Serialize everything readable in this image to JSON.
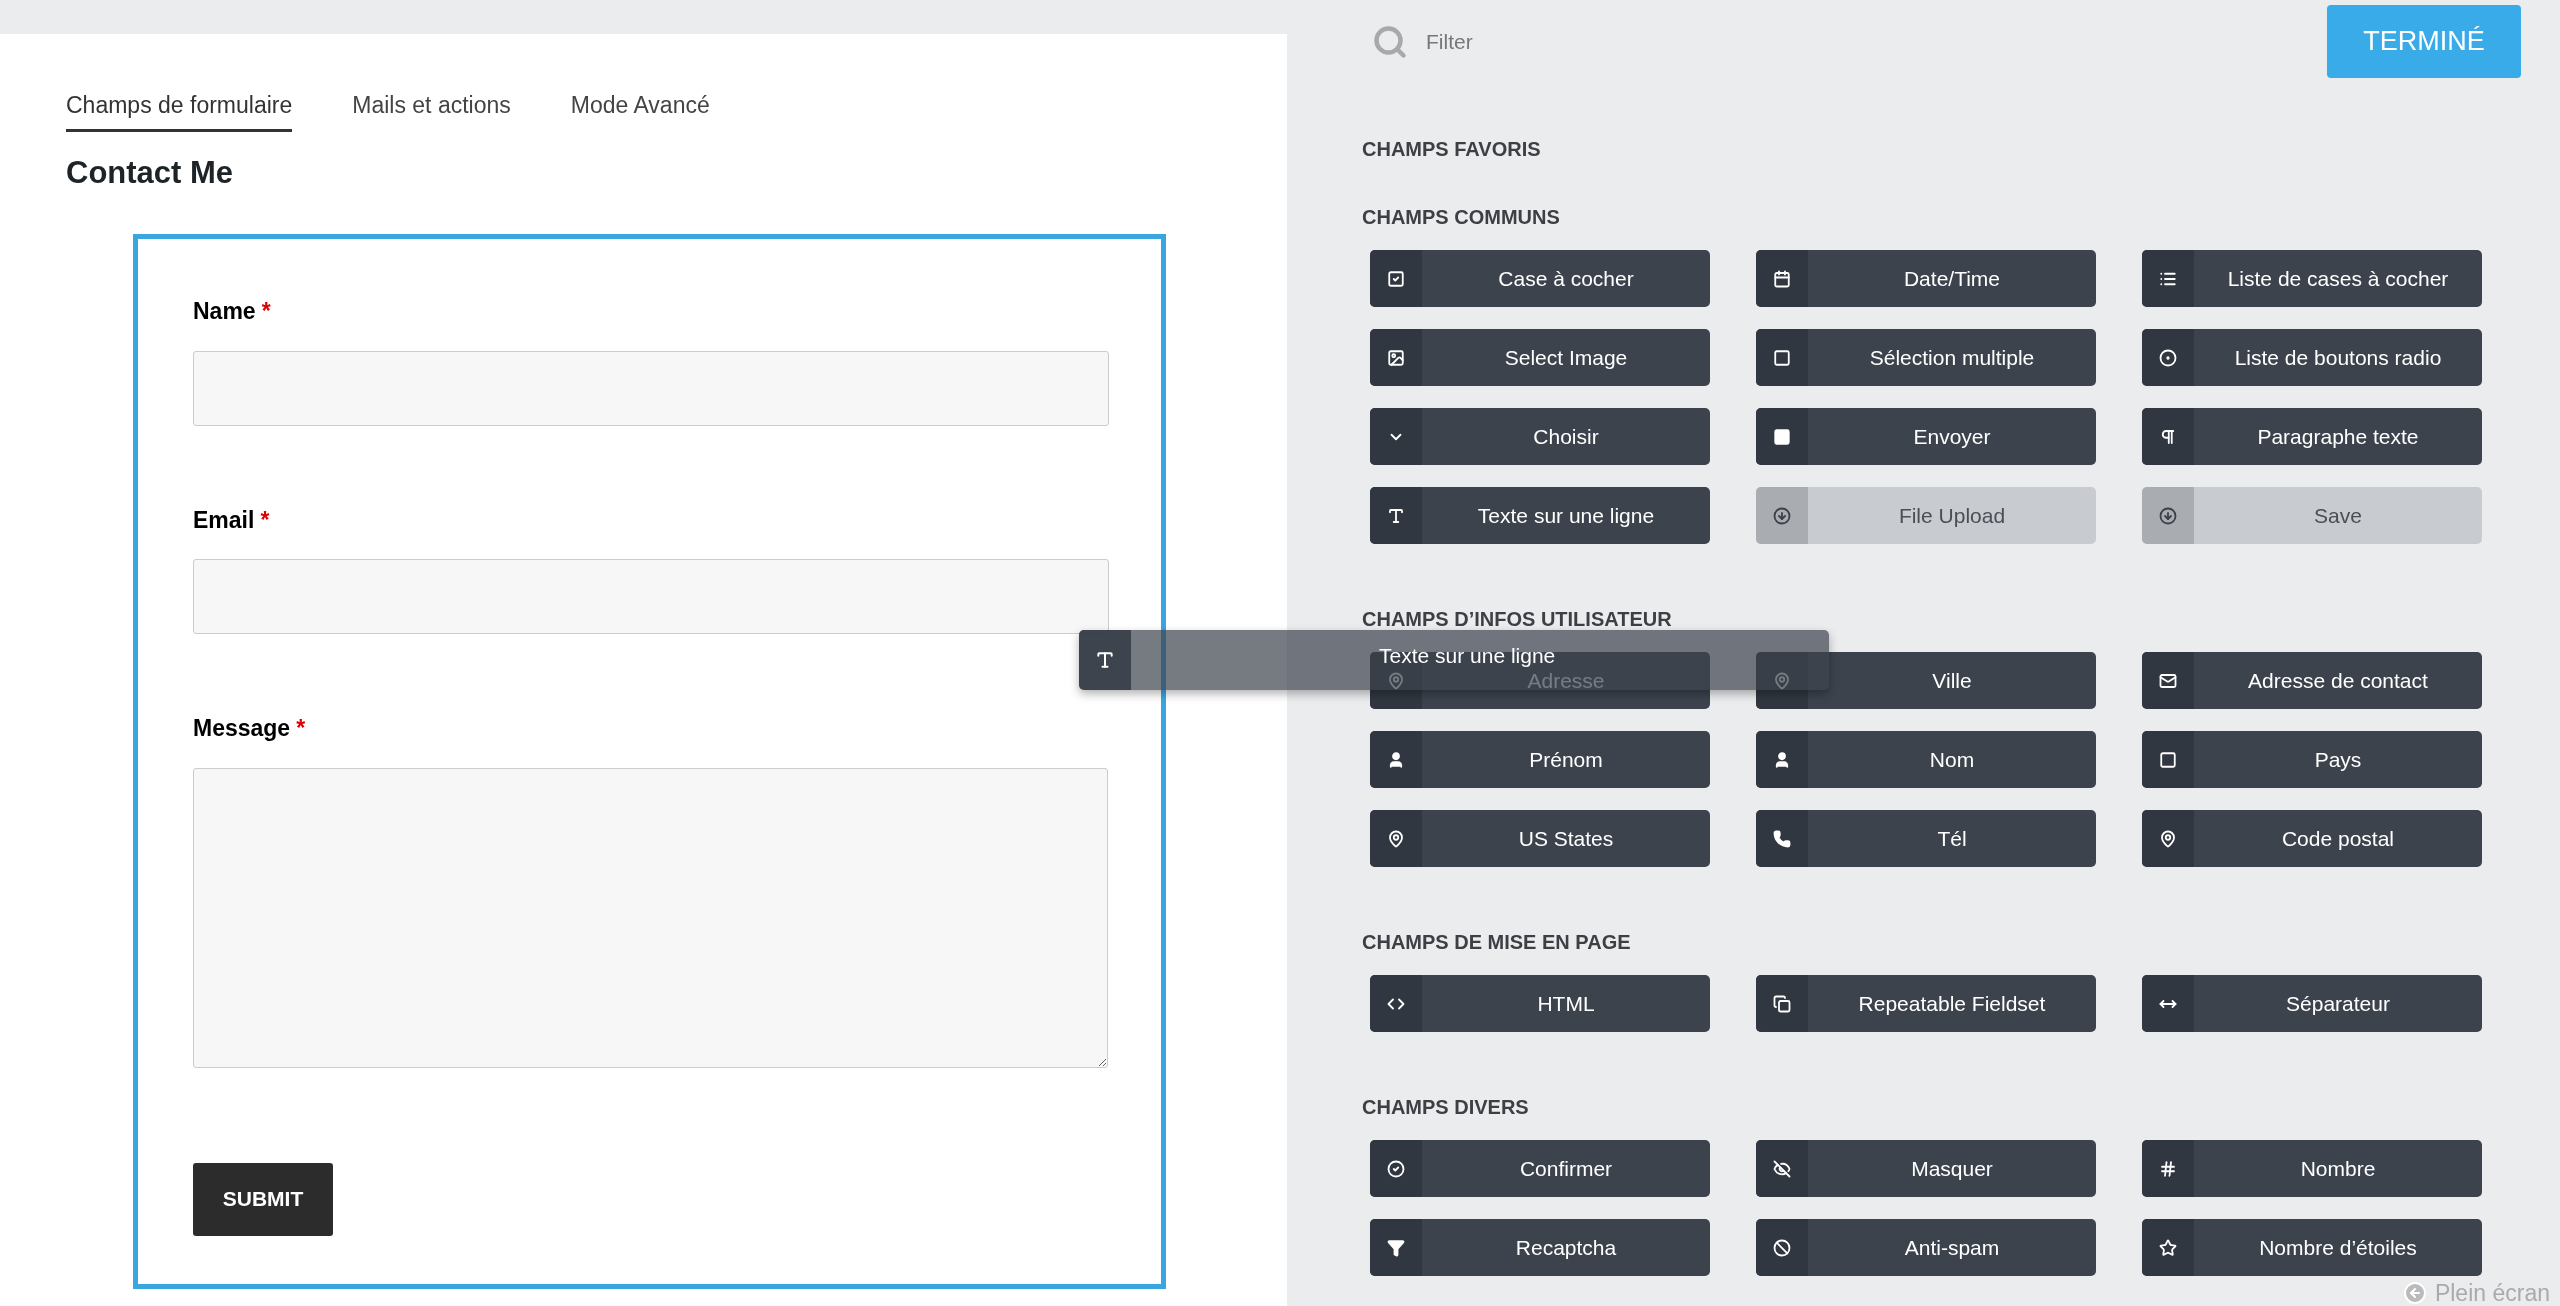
{
  "tabs": [
    {
      "label": "Champs de formulaire",
      "selected": true
    },
    {
      "label": "Mails et actions",
      "selected": false
    },
    {
      "label": "Mode Avancé",
      "selected": false
    }
  ],
  "form_title": "Contact Me",
  "form": {
    "fields": [
      {
        "kind": "input",
        "label": "Name",
        "required_mark": "*"
      },
      {
        "kind": "input",
        "label": "Email",
        "required_mark": "*"
      },
      {
        "kind": "textarea",
        "label": "Message",
        "required_mark": "*"
      }
    ],
    "submit": "SUBMIT"
  },
  "filter": {
    "placeholder": "Filter"
  },
  "done_button": "TERMINÉ",
  "sections": [
    {
      "title": "CHAMPS FAVORIS"
    },
    {
      "title": "CHAMPS COMMUNS",
      "items": [
        {
          "label": "Case à cocher",
          "disabled": false
        },
        {
          "label": "Date/Time",
          "disabled": false
        },
        {
          "label": "Liste de cases à cocher",
          "disabled": false
        },
        {
          "label": "Select Image",
          "disabled": false
        },
        {
          "label": "Sélection multiple",
          "disabled": false
        },
        {
          "label": "Liste de boutons radio",
          "disabled": false
        },
        {
          "label": "Choisir",
          "disabled": false
        },
        {
          "label": "Envoyer",
          "disabled": false
        },
        {
          "label": "Paragraphe texte",
          "disabled": false
        },
        {
          "label": "Texte sur une ligne",
          "disabled": false
        },
        {
          "label": "File Upload",
          "disabled": true
        },
        {
          "label": "Save",
          "disabled": true
        }
      ]
    },
    {
      "title": "CHAMPS D’INFOS UTILISATEUR",
      "items": [
        {
          "label": "Adresse",
          "disabled": false
        },
        {
          "label": "Ville",
          "disabled": false
        },
        {
          "label": "Adresse de contact",
          "disabled": false
        },
        {
          "label": "Prénom",
          "disabled": false
        },
        {
          "label": "Nom",
          "disabled": false
        },
        {
          "label": "Pays",
          "disabled": false
        },
        {
          "label": "US States",
          "disabled": false
        },
        {
          "label": "Tél",
          "disabled": false
        },
        {
          "label": "Code postal",
          "disabled": false
        }
      ]
    },
    {
      "title": "CHAMPS DE MISE EN PAGE",
      "items": [
        {
          "label": "HTML",
          "disabled": false
        },
        {
          "label": "Repeatable Fieldset",
          "disabled": false
        },
        {
          "label": "Séparateur",
          "disabled": false
        }
      ]
    },
    {
      "title": "CHAMPS DIVERS",
      "items": [
        {
          "label": "Confirmer",
          "disabled": false
        },
        {
          "label": "Masquer",
          "disabled": false
        },
        {
          "label": "Nombre",
          "disabled": false
        },
        {
          "label": "Recaptcha",
          "disabled": false
        },
        {
          "label": "Anti-spam",
          "disabled": false
        },
        {
          "label": "Nombre d’étoiles",
          "disabled": false
        }
      ]
    }
  ],
  "drag_ghost": {
    "label": "Texte sur une ligne"
  },
  "fullscreen_link": "Plein écran"
}
